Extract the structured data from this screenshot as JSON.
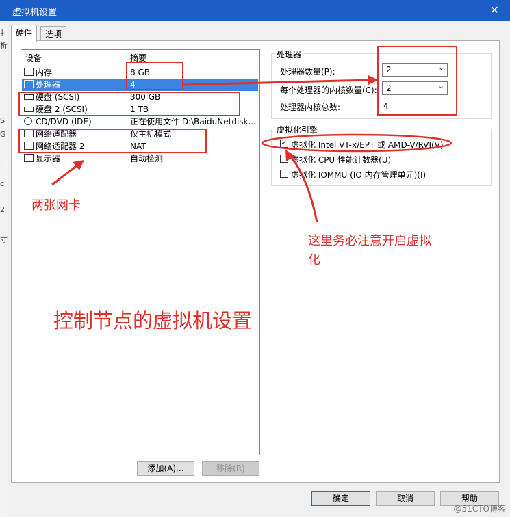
{
  "window": {
    "title": "虚拟机设置",
    "close": "✕"
  },
  "tabs": [
    {
      "label": "硬件"
    },
    {
      "label": "选项"
    }
  ],
  "device_list": {
    "columns": [
      "设备",
      "摘要"
    ],
    "rows": [
      {
        "name": "内存",
        "summary": "8 GB"
      },
      {
        "name": "处理器",
        "summary": "4"
      },
      {
        "name": "硬盘 (SCSI)",
        "summary": "300 GB"
      },
      {
        "name": "硬盘 2 (SCSI)",
        "summary": "1 TB"
      },
      {
        "name": "CD/DVD (IDE)",
        "summary": "正在使用文件 D:\\BaiduNetdisk..."
      },
      {
        "name": "网络适配器",
        "summary": "仅主机模式"
      },
      {
        "name": "网络适配器 2",
        "summary": "NAT"
      },
      {
        "name": "显示器",
        "summary": "自动检测"
      }
    ],
    "selected_index": 1,
    "add_button": "添加(A)...",
    "remove_button": "移除(R)"
  },
  "processor": {
    "group_label": "处理器",
    "count_label": "处理器数量(P):",
    "count_value": "2",
    "cores_label": "每个处理器的内核数量(C):",
    "cores_value": "2",
    "total_label": "处理器内核总数:",
    "total_value": "4"
  },
  "virtualization": {
    "group_label": "虚拟化引擎",
    "options": [
      {
        "label": "虚拟化 Intel VT-x/EPT 或 AMD-V/RVI(V)",
        "checked": true
      },
      {
        "label": "虚拟化 CPU 性能计数器(U)",
        "checked": false
      },
      {
        "label": "虚拟化 IOMMU (IO 内存管理单元)(I)",
        "checked": false
      }
    ]
  },
  "footer": {
    "ok": "确定",
    "cancel": "取消",
    "help": "帮助"
  },
  "annotations": {
    "nics": "两张网卡",
    "virt_note_line1": "这里务必注意开启虚拟",
    "virt_note_line2": "化",
    "caption": "控制节点的虚拟机设置",
    "color": "#e0302a"
  },
  "left_edge_fragments": [
    "扌",
    "析",
    "S",
    "G",
    "l",
    "c",
    "2",
    "寸"
  ],
  "watermark": "@51CTO博客"
}
